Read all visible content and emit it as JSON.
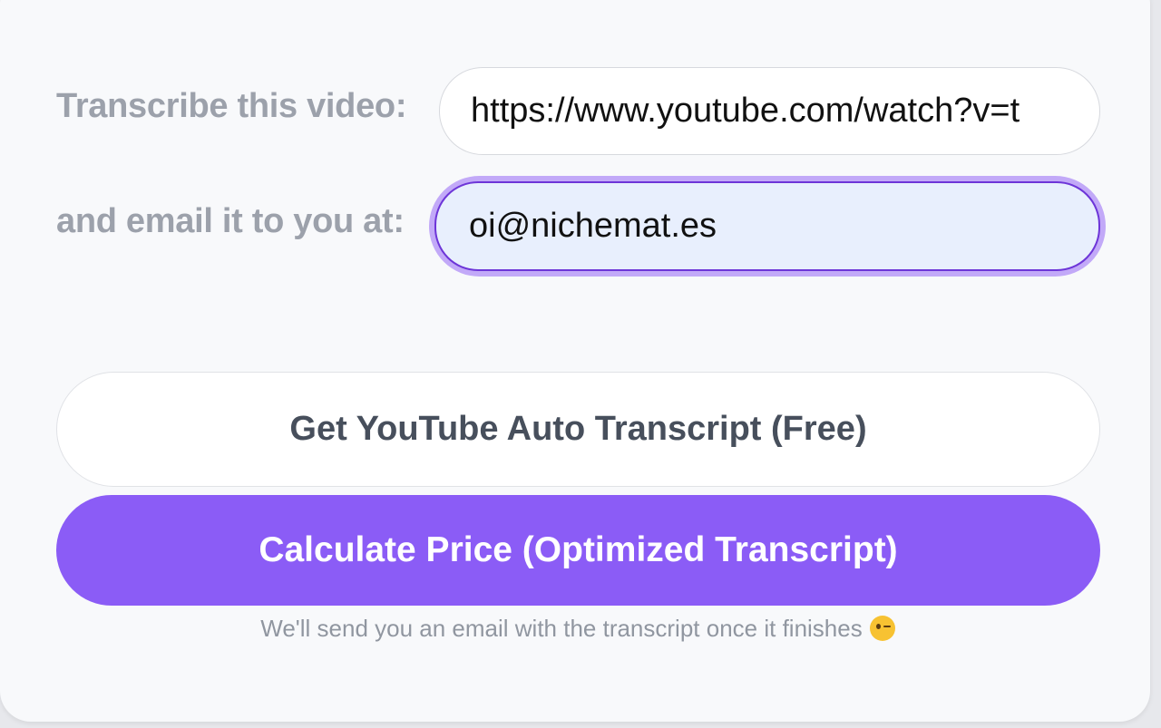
{
  "form": {
    "video_label": "Transcribe this video:",
    "video_url_value": "https://www.youtube.com/watch?v=t",
    "email_label": "and email it to you at:",
    "email_value": "oi@nichemat.es"
  },
  "buttons": {
    "free_transcript_label": "Get YouTube Auto Transcript (Free)",
    "calculate_price_label": "Calculate Price (Optimized Transcript)"
  },
  "footer": {
    "note_text": "We'll send you an email with the transcript once it finishes",
    "note_emoji_icon": "winking-face-icon"
  },
  "colors": {
    "accent": "#8b5cf6",
    "focus_border": "#6d35d8",
    "focus_ring": "#c2a9f8",
    "focused_field_bg": "#e8effd",
    "label_gray": "#9ca1ab"
  }
}
